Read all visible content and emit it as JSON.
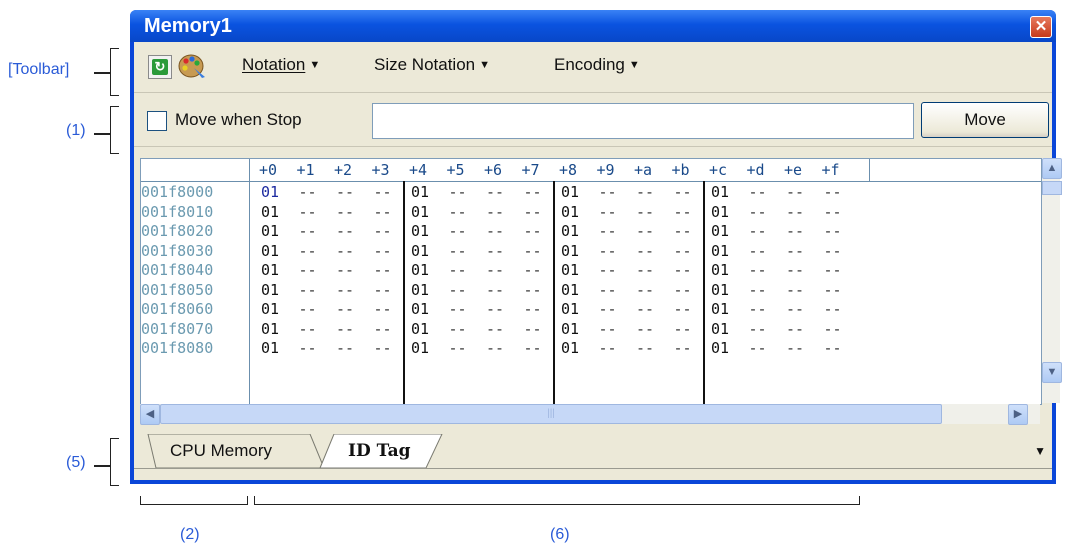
{
  "callouts": {
    "toolbar": "[Toolbar]",
    "one": "(1)",
    "five": "(5)",
    "two": "(2)",
    "six": "(6)"
  },
  "window": {
    "title": "Memory1",
    "close_glyph": "✕"
  },
  "toolbar": {
    "refresh_icon": "refresh-icon",
    "palette_icon": "palette-icon",
    "menus": [
      {
        "label": "Notation"
      },
      {
        "label": "Size Notation"
      },
      {
        "label": "Encoding"
      }
    ]
  },
  "move_bar": {
    "checkbox_label": "Move when Stop",
    "checked": false,
    "address_value": "",
    "move_button": "Move"
  },
  "grid": {
    "columns": [
      "+0",
      "+1",
      "+2",
      "+3",
      "+4",
      "+5",
      "+6",
      "+7",
      "+8",
      "+9",
      "+a",
      "+b",
      "+c",
      "+d",
      "+e",
      "+f"
    ],
    "rows": [
      {
        "address": "001f8000",
        "values": [
          "01",
          "--",
          "--",
          "--",
          "01",
          "--",
          "--",
          "--",
          "01",
          "--",
          "--",
          "--",
          "01",
          "--",
          "--",
          "--"
        ]
      },
      {
        "address": "001f8010",
        "values": [
          "01",
          "--",
          "--",
          "--",
          "01",
          "--",
          "--",
          "--",
          "01",
          "--",
          "--",
          "--",
          "01",
          "--",
          "--",
          "--"
        ]
      },
      {
        "address": "001f8020",
        "values": [
          "01",
          "--",
          "--",
          "--",
          "01",
          "--",
          "--",
          "--",
          "01",
          "--",
          "--",
          "--",
          "01",
          "--",
          "--",
          "--"
        ]
      },
      {
        "address": "001f8030",
        "values": [
          "01",
          "--",
          "--",
          "--",
          "01",
          "--",
          "--",
          "--",
          "01",
          "--",
          "--",
          "--",
          "01",
          "--",
          "--",
          "--"
        ]
      },
      {
        "address": "001f8040",
        "values": [
          "01",
          "--",
          "--",
          "--",
          "01",
          "--",
          "--",
          "--",
          "01",
          "--",
          "--",
          "--",
          "01",
          "--",
          "--",
          "--"
        ]
      },
      {
        "address": "001f8050",
        "values": [
          "01",
          "--",
          "--",
          "--",
          "01",
          "--",
          "--",
          "--",
          "01",
          "--",
          "--",
          "--",
          "01",
          "--",
          "--",
          "--"
        ]
      },
      {
        "address": "001f8060",
        "values": [
          "01",
          "--",
          "--",
          "--",
          "01",
          "--",
          "--",
          "--",
          "01",
          "--",
          "--",
          "--",
          "01",
          "--",
          "--",
          "--"
        ]
      },
      {
        "address": "001f8070",
        "values": [
          "01",
          "--",
          "--",
          "--",
          "01",
          "--",
          "--",
          "--",
          "01",
          "--",
          "--",
          "--",
          "01",
          "--",
          "--",
          "--"
        ]
      },
      {
        "address": "001f8080",
        "values": [
          "01",
          "--",
          "--",
          "--",
          "01",
          "--",
          "--",
          "--",
          "01",
          "--",
          "--",
          "--",
          "01",
          "--",
          "--",
          "--"
        ]
      }
    ]
  },
  "scroll": {
    "up": "▲",
    "down": "▼",
    "left": "◀",
    "right": "▶",
    "grip": "|||"
  },
  "tabs": [
    {
      "label": "CPU Memory",
      "active": false
    },
    {
      "label": "ID Tag",
      "active": true
    }
  ],
  "tab_dropdown": "▼"
}
